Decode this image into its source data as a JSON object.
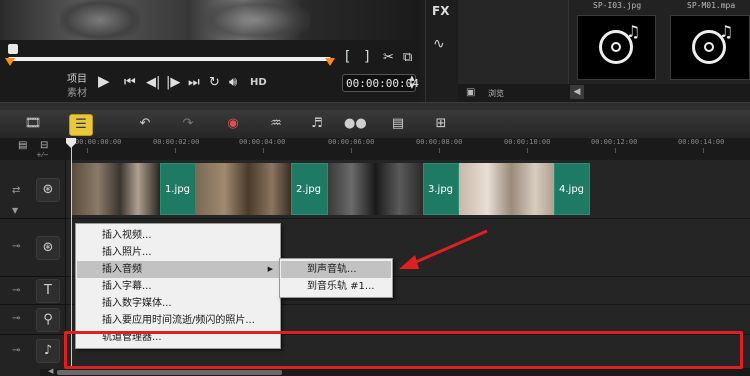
{
  "player": {
    "project_label": "项目",
    "clip_label": "素材",
    "hd_label": "HD",
    "timecode": "00:00:00:04",
    "bracket_in": "[",
    "bracket_out": "]"
  },
  "library": {
    "fx_label": "FX",
    "browse_label": "浏览",
    "thumbs": [
      {
        "name": "SP-I03.jpg",
        "caption": "SP-I03"
      },
      {
        "name": "SP-M01.mpa",
        "caption": "SP-M01"
      }
    ]
  },
  "ruler": {
    "ticks": [
      "00:00:00:00",
      "00:00:02:00",
      "00:00:04:00",
      "00:00:06:00",
      "00:00:08:00",
      "00:00:10:00",
      "00:00:12:00",
      "00:00:14:00"
    ]
  },
  "clips": [
    {
      "label": "1.jpg"
    },
    {
      "label": "2.jpg"
    },
    {
      "label": "3.jpg"
    },
    {
      "label": "4.jpg"
    }
  ],
  "context_menu": {
    "items": [
      {
        "label": "插入视频..."
      },
      {
        "label": "插入照片..."
      },
      {
        "label": "插入音频",
        "submenu": true
      },
      {
        "label": "插入字幕..."
      },
      {
        "label": "插入数字媒体..."
      },
      {
        "label": "插入要应用时间流逝/频闪的照片..."
      },
      {
        "label": "轨道管理器..."
      }
    ],
    "submenu": [
      {
        "label": "到声音轨..."
      },
      {
        "label": "到音乐轨 #1..."
      }
    ]
  },
  "icons": {
    "arrow_color": "#e02020",
    "highlight_box_color": "#e02020"
  }
}
